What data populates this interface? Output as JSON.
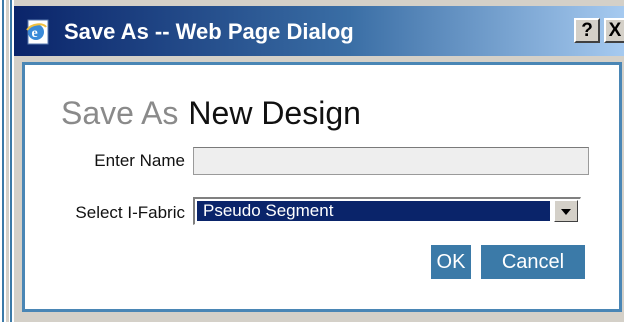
{
  "window": {
    "title": "Save As -- Web Page Dialog",
    "help_label": "?",
    "close_label": "X"
  },
  "dialog": {
    "heading_prefix": "Save As",
    "heading_main": "New Design",
    "name_label": "Enter Name",
    "name_value": "",
    "fabric_label": "Select I-Fabric",
    "fabric_selected": "Pseudo Segment",
    "ok_label": "OK",
    "cancel_label": "Cancel"
  },
  "colors": {
    "title_gradient_start": "#0a246a",
    "button_bg": "#3b7aa8",
    "frame_border": "#4a86b5",
    "selection_bg": "#0a246a"
  },
  "icons": {
    "title_icon": "ie-page-icon",
    "dropdown_icon": "chevron-down-icon"
  }
}
